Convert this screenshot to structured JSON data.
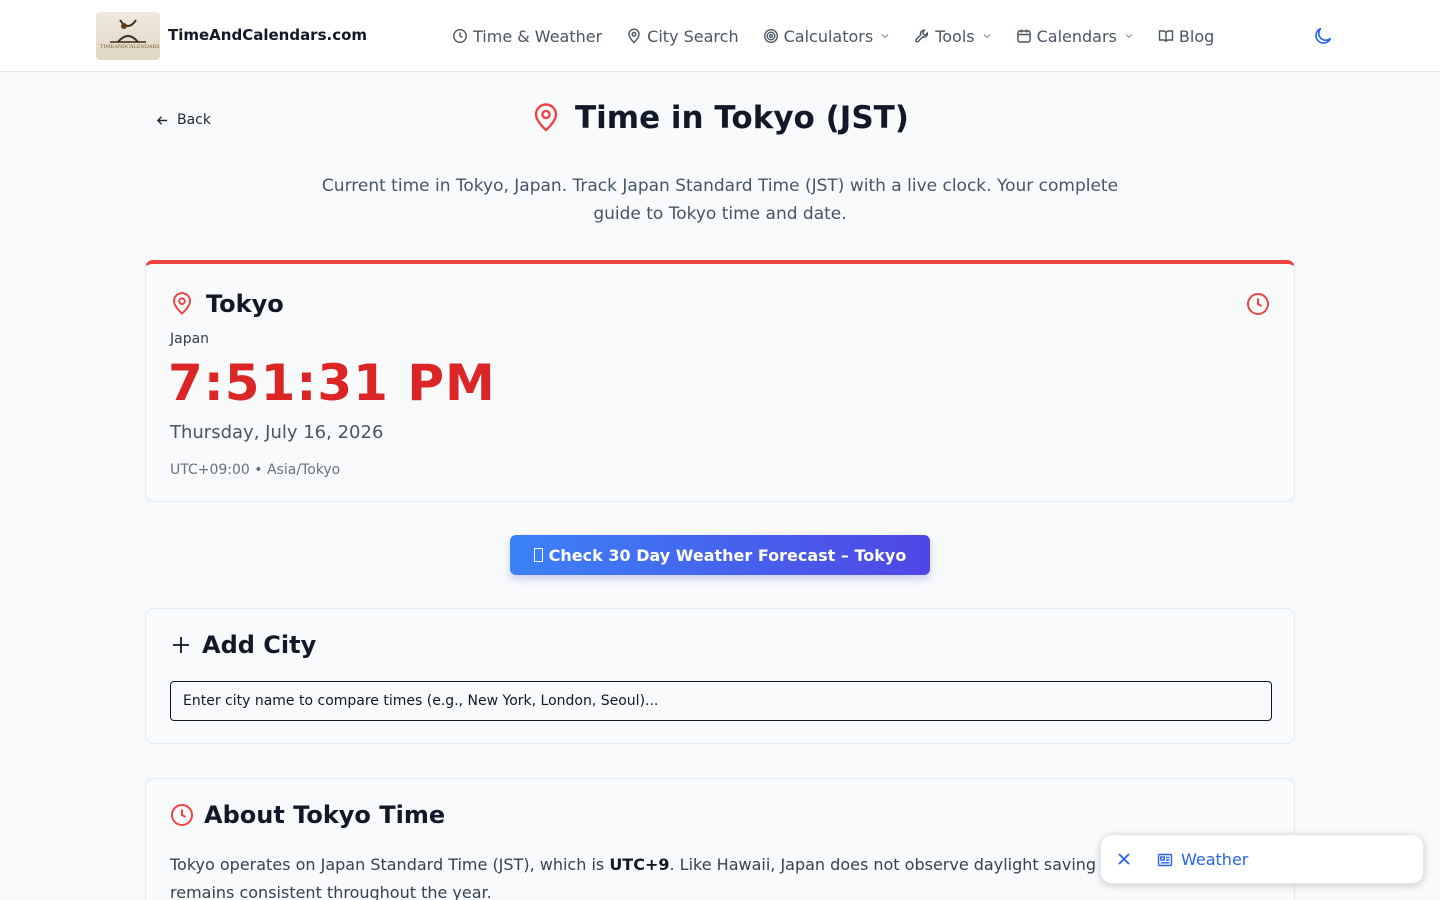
{
  "header": {
    "logo_text": "TIMEANDCALENDARS",
    "brand": "TimeAndCalendars.com",
    "nav": [
      {
        "label": "Time & Weather",
        "icon": "clock-icon"
      },
      {
        "label": "City Search",
        "icon": "map-pin-icon"
      },
      {
        "label": "Calculators",
        "icon": "target-icon",
        "dropdown": true
      },
      {
        "label": "Tools",
        "icon": "wrench-icon",
        "dropdown": true
      },
      {
        "label": "Calendars",
        "icon": "calendar-icon",
        "dropdown": true
      },
      {
        "label": "Blog",
        "icon": "book-icon"
      }
    ],
    "theme_icon": "moon-icon"
  },
  "page": {
    "back_label": "Back",
    "title": "Time in Tokyo (JST)",
    "subtitle": "Current time in Tokyo, Japan. Track Japan Standard Time (JST) with a live clock. Your complete guide to Tokyo time and date."
  },
  "city_card": {
    "city": "Tokyo",
    "country": "Japan",
    "time": "7:51:31 PM",
    "date": "Thursday, July 16, 2026",
    "tz": "UTC+09:00 • Asia/Tokyo"
  },
  "forecast_button": "Check 30 Day Weather Forecast – Tokyo",
  "add_city": {
    "title": "Add City",
    "placeholder": "Enter city name to compare times (e.g., New York, London, Seoul)..."
  },
  "about": {
    "title": "About Tokyo Time",
    "text_before": "Tokyo operates on Japan Standard Time (JST), which is ",
    "text_bold": "UTC+9",
    "text_after": ". Like Hawaii, Japan does not observe daylight saving",
    "text_line2": "remains consistent throughout the year."
  },
  "weather_widget": {
    "label": "Weather"
  },
  "colors": {
    "accent_red": "#dc2626",
    "accent_blue": "#2563eb",
    "button_gradient_start": "#3b82f6",
    "button_gradient_end": "#4f46e5"
  }
}
